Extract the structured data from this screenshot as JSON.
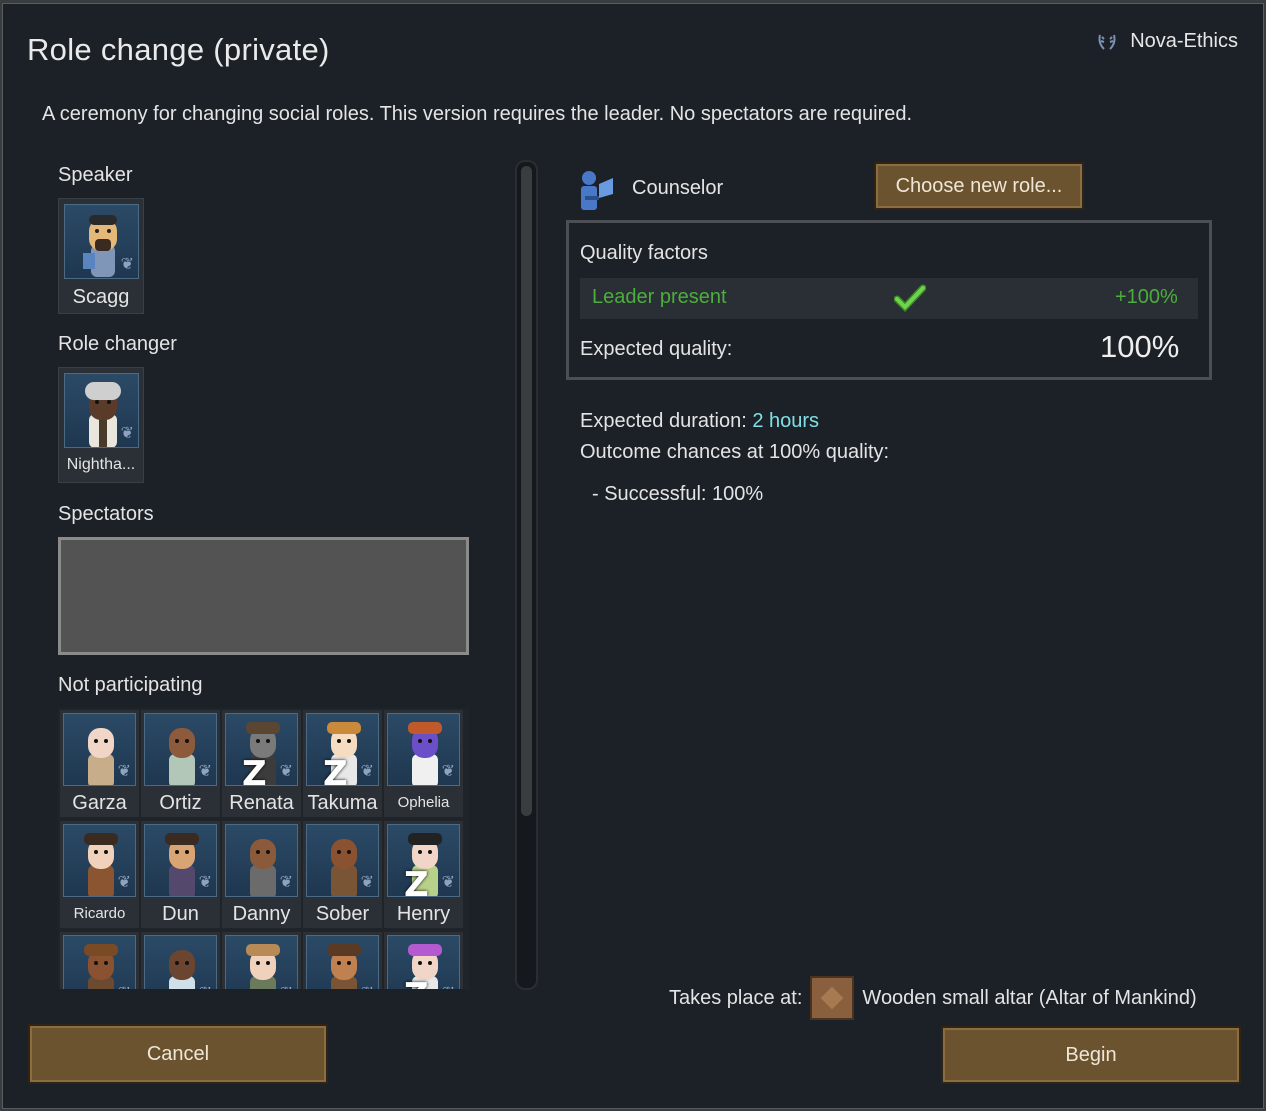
{
  "dialog": {
    "title": "Role change (private)",
    "ideology": "Nova-Ethics",
    "description": "A ceremony for changing social roles. This version requires the leader. No spectators are required."
  },
  "speaker": {
    "label": "Speaker",
    "name": "Scagg"
  },
  "role_changer": {
    "label": "Role changer",
    "name": "Nightha..."
  },
  "spectators": {
    "label": "Spectators"
  },
  "not_participating": {
    "label": "Not participating",
    "pawns": [
      {
        "name": "Garza",
        "skin": "#f1d6c7",
        "hat": "",
        "body": "#c7ad8a",
        "sleeping": false
      },
      {
        "name": "Ortiz",
        "skin": "#8d5a3b",
        "hat": "",
        "body": "#b3c7b8",
        "sleeping": false
      },
      {
        "name": "Renata",
        "skin": "#7a7a7a",
        "hat": "#5b4634",
        "body": "#3c3c3c",
        "sleeping": true
      },
      {
        "name": "Takuma",
        "skin": "#f6dcc0",
        "hat": "#c98a3c",
        "body": "#e8e8e8",
        "sleeping": true
      },
      {
        "name": "Ophelia",
        "skin": "#6a4fc9",
        "hat": "#c05a2a",
        "body": "#f0f0f0",
        "sleeping": false
      },
      {
        "name": "Ricardo",
        "skin": "#f0d2bc",
        "hat": "#3a2a20",
        "body": "#8a5530",
        "sleeping": false
      },
      {
        "name": "Dun",
        "skin": "#d8a473",
        "hat": "#3a2a20",
        "body": "#54496c",
        "sleeping": false
      },
      {
        "name": "Danny",
        "skin": "#8a5a3a",
        "hat": "",
        "body": "#6b6b6b",
        "sleeping": false
      },
      {
        "name": "Sober",
        "skin": "#8a5230",
        "hat": "",
        "body": "#7a5535",
        "sleeping": false
      },
      {
        "name": "Henry",
        "skin": "#f1d6c7",
        "hat": "#222222",
        "body": "#b8d18a",
        "sleeping": true
      },
      {
        "name": "",
        "skin": "#8a5230",
        "hat": "#7a4a25",
        "body": "#6b4a30",
        "sleeping": false
      },
      {
        "name": "",
        "skin": "#6b4530",
        "hat": "",
        "body": "#cfe0e8",
        "sleeping": false
      },
      {
        "name": "",
        "skin": "#f0d2bc",
        "hat": "#b88a55",
        "body": "#6b7a5a",
        "sleeping": false
      },
      {
        "name": "",
        "skin": "#c08050",
        "hat": "#5a3a25",
        "body": "#7a5535",
        "sleeping": false
      },
      {
        "name": "",
        "skin": "#f1d6c7",
        "hat": "#b35ad0",
        "body": "#e8e8e8",
        "sleeping": true
      }
    ]
  },
  "role": {
    "name": "Counselor",
    "choose_button": "Choose new role..."
  },
  "quality": {
    "title": "Quality factors",
    "factor_label": "Leader present",
    "factor_value": "+100%",
    "expected_label": "Expected quality:",
    "expected_value": "100%"
  },
  "outcome": {
    "duration_label": "Expected duration:",
    "duration_value": "2 hours",
    "chances_label": "Outcome chances at 100% quality:",
    "success_line": "- Successful: 100%"
  },
  "place": {
    "label": "Takes place at:",
    "value": "Wooden small altar (Altar of Mankind)"
  },
  "buttons": {
    "cancel": "Cancel",
    "begin": "Begin"
  },
  "colors": {
    "background": "#1c2127",
    "positive": "#4cae3c",
    "highlight": "#7fe0e6",
    "button": "#6b5330"
  }
}
